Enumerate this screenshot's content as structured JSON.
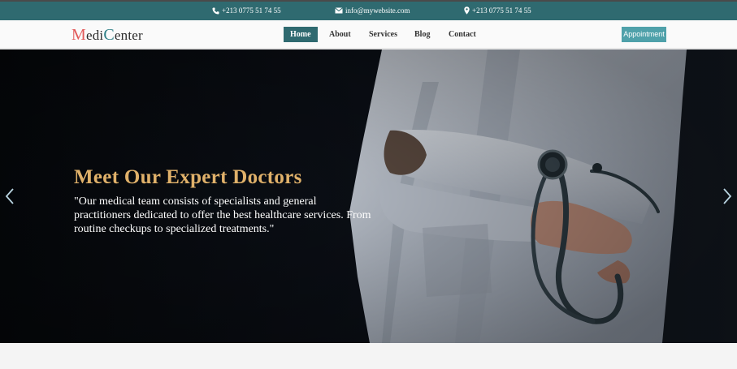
{
  "topbar": {
    "phone_left": "+213 0775 51 74 55",
    "email": "info@mywebsite.com",
    "phone_right": "+213 0775 51 74 55"
  },
  "logo": {
    "first_initial": "M",
    "first_rest": "edi",
    "second_initial": "C",
    "second_rest": "enter"
  },
  "nav": {
    "items": [
      {
        "label": "Home",
        "active": true
      },
      {
        "label": "About"
      },
      {
        "label": "Services"
      },
      {
        "label": "Blog"
      },
      {
        "label": "Contact"
      }
    ],
    "appointment_label": "Appointment"
  },
  "hero": {
    "title": "Meet Our Expert Doctors",
    "text": "\"Our medical team consists of specialists and general practitioners dedicated to offer the best healthcare services. From routine checkups to specialized treatments.\""
  },
  "colors": {
    "topbar_bg": "#2f6a70",
    "accent_gold": "#e0b16a",
    "logo_red": "#e25a5a",
    "logo_teal": "#2f7f86",
    "button_teal": "#4fa1aa"
  },
  "icons": {
    "phone": "phone-icon",
    "email": "envelope-icon",
    "location": "map-pin-icon",
    "prev": "chevron-left-icon",
    "next": "chevron-right-icon"
  }
}
